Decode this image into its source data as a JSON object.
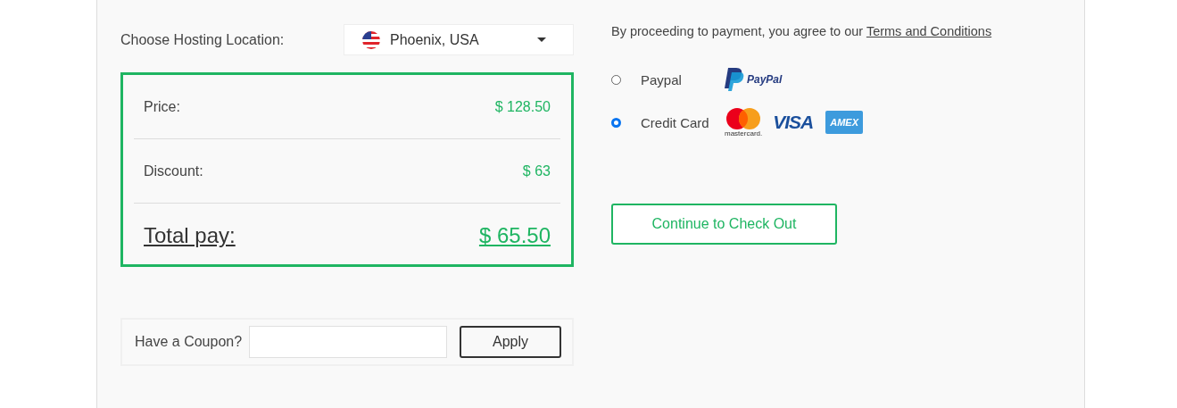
{
  "location": {
    "label": "Choose Hosting Location:",
    "value": "Phoenix, USA"
  },
  "summary": {
    "rows": [
      {
        "label": "Price:",
        "value": "$ 128.50",
        "kind": "line"
      },
      {
        "label": "Discount:",
        "value": "$ 63",
        "kind": "line"
      },
      {
        "label": "Total pay:",
        "value": "$ 65.50",
        "kind": "total"
      }
    ]
  },
  "coupon": {
    "label": "Have a Coupon?",
    "button": "Apply"
  },
  "terms": {
    "text": "By proceeding to payment, you agree to our",
    "link": "Terms and Conditions"
  },
  "payment_methods": [
    {
      "label": "Paypal",
      "selected": false,
      "logos": [
        {
          "kind": "paypal",
          "text": "PayPal"
        }
      ]
    },
    {
      "label": "Credit Card",
      "selected": true,
      "logos": [
        {
          "kind": "mastercard",
          "text": "mastercard."
        },
        {
          "kind": "visa",
          "text": "VISA"
        },
        {
          "kind": "amex",
          "text": "AMEX"
        }
      ]
    }
  ],
  "checkout_button": "Continue to Check Out"
}
